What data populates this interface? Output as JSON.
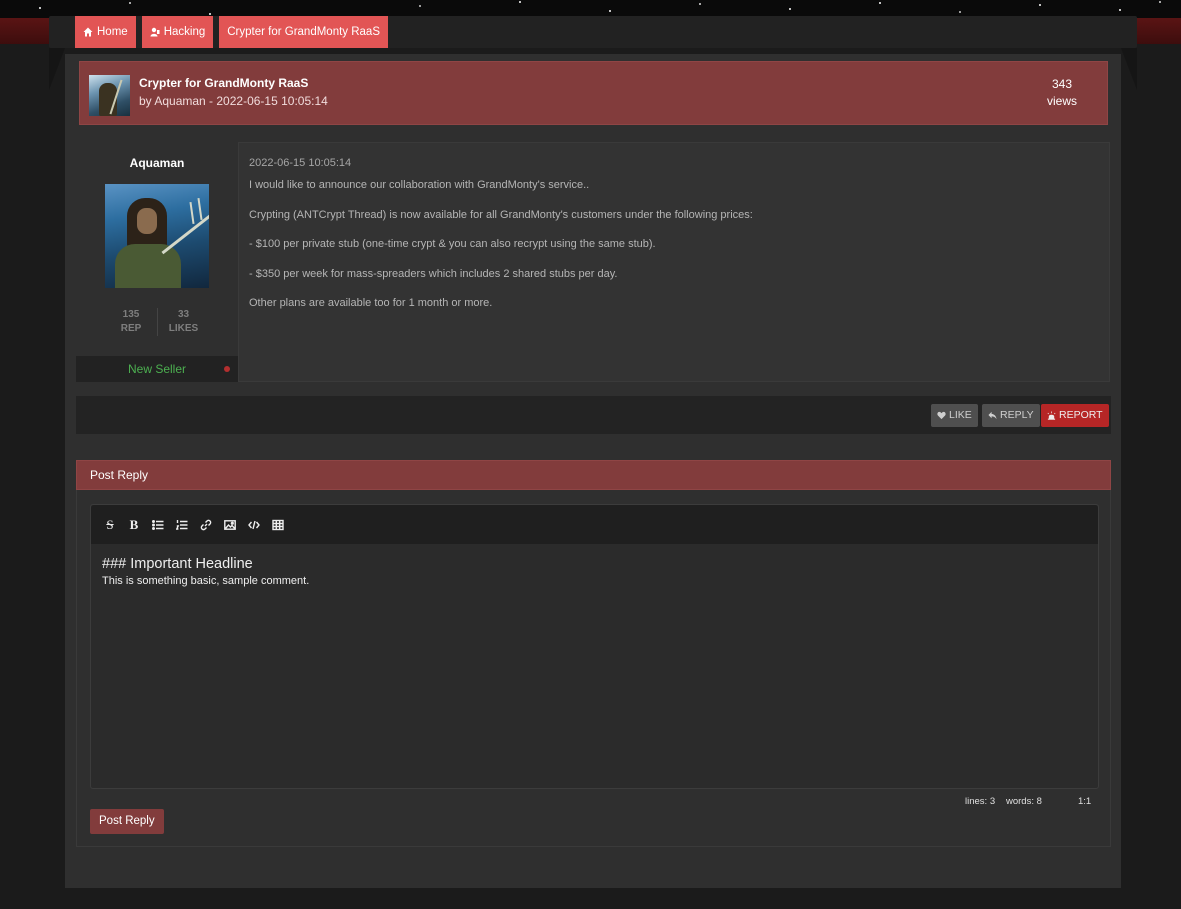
{
  "breadcrumbs": [
    {
      "label": "Home",
      "icon": "home-icon"
    },
    {
      "label": "Hacking",
      "icon": "user-icon"
    },
    {
      "label": "Crypter for GrandMonty RaaS"
    }
  ],
  "thread": {
    "title": "Crypter for GrandMonty RaaS",
    "byline": "by Aquaman - 2022-06-15 10:05:14",
    "views_count": "343",
    "views_label": "views"
  },
  "post": {
    "author": "Aquaman",
    "rep_value": "135",
    "rep_label": "REP",
    "likes_value": "33",
    "likes_label": "LIKES",
    "rank": "New Seller",
    "date": "2022-06-15 10:05:14",
    "paragraphs": [
      "I would like to announce our collaboration with GrandMonty's service..",
      "Crypting (ANTCrypt Thread) is now available for all GrandMonty's customers under the following prices:",
      "- $100 per private stub (one-time crypt & you can also recrypt using the same stub).",
      "- $350 per week for mass-spreaders which includes 2 shared stubs per day.",
      "Other plans are available too for 1 month or more."
    ],
    "actions": {
      "like": "LIKE",
      "reply": "REPLY",
      "report": "REPORT"
    }
  },
  "reply": {
    "header": "Post Reply",
    "toolbar": [
      "strikethrough-icon",
      "bold-icon",
      "bullet-list-icon",
      "numbered-list-icon",
      "link-icon",
      "image-icon",
      "code-icon",
      "table-icon"
    ],
    "editor_heading": "### Important Headline",
    "editor_body": "This is something basic, sample comment.",
    "status_lines": "lines: 3",
    "status_words": "words: 8",
    "status_cursor": "1:1",
    "submit_label": "Post Reply"
  },
  "colors": {
    "accent": "#e25555",
    "header_bg": "#823c3c",
    "rank_color": "#4caf50",
    "report_bg": "#b62626"
  }
}
